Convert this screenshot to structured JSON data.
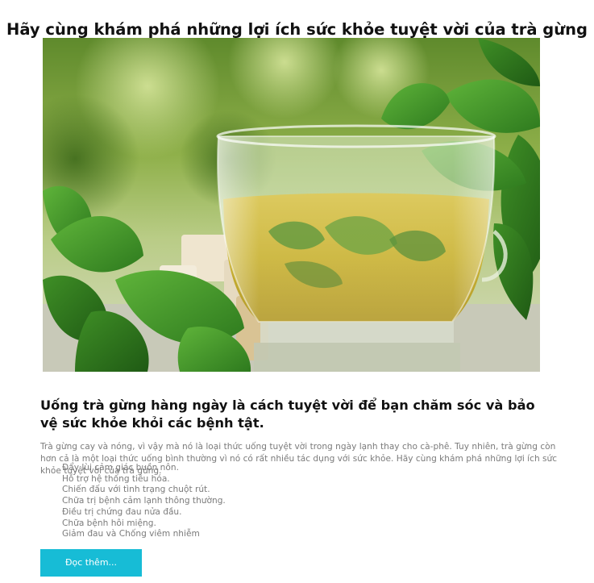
{
  "page": {
    "title": "Hãy cùng khám phá những lợi ích sức khỏe tuyệt vời của trà gừng"
  },
  "hero_image": {
    "subject": "glass-cup-of-ginger-tea-with-mint-leaves"
  },
  "article": {
    "subtitle": "Uống trà gừng hàng ngày là cách tuyệt vời để bạn chăm sóc và bảo vệ sức khỏe khỏi các bệnh tật.",
    "intro": "Trà gừng cay và nóng, vì vậy mà nó là loại thức uống tuyệt vời trong ngày lạnh thay cho cà-phê. Tuy nhiên, trà gừng còn hơn cả là một loại thức uống bình thường vì nó có rất nhiều tác dụng với sức khỏe. Hãy cùng khám phá những lợi ích sức khỏe tuyệt vời của trà gừng.",
    "benefits": [
      "Đẩy lùi cảm giác buồn nôn.",
      "Hỗ trợ hệ thống tiêu hóa.",
      "Chiến đấu với tình trạng chuột rút.",
      "Chữa trị bệnh cảm lạnh thông thường.",
      "Điều trị chứng đau nửa đầu.",
      "Chữa bệnh hôi miệng.",
      "Giảm đau và Chống viêm nhiễm"
    ],
    "read_more_label": "Đọc thêm..."
  },
  "colors": {
    "button_bg": "#17bcd6",
    "button_text": "#ffffff",
    "heading_text": "#111111",
    "body_text": "#7b7b7b"
  }
}
